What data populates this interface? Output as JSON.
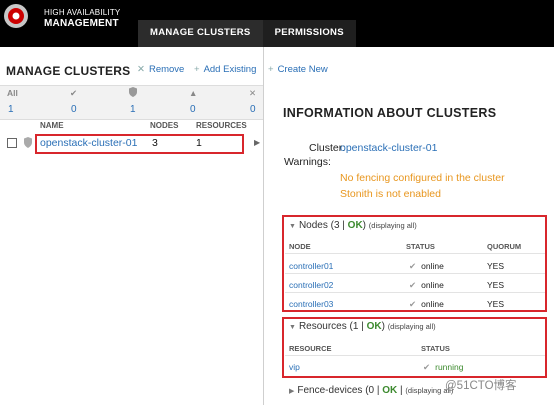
{
  "brand": {
    "line1": "HIGH AVAILABILITY",
    "line2": "MANAGEMENT"
  },
  "nav": {
    "tabs": [
      "MANAGE CLUSTERS",
      "PERMISSIONS"
    ]
  },
  "left": {
    "title": "MANAGE CLUSTERS",
    "actions": {
      "remove": "Remove",
      "add": "Add Existing",
      "create": "Create New"
    },
    "filters": {
      "all_label": "All",
      "counts": [
        "1",
        "0",
        "1",
        "0",
        "0"
      ]
    },
    "columns": {
      "name": "NAME",
      "nodes": "NODES",
      "resources": "RESOURCES"
    },
    "clusters": [
      {
        "name": "openstack-cluster-01",
        "nodes": "3",
        "resources": "1"
      }
    ]
  },
  "right": {
    "title": "INFORMATION ABOUT CLUSTERS",
    "cluster_label": "Cluster:",
    "cluster_value": "openstack-cluster-01",
    "warnings_label": "Warnings:",
    "warnings": [
      "No fencing configured in the cluster",
      "Stonith is not enabled"
    ],
    "nodes": {
      "header_prefix": "Nodes (3 | ",
      "ok": "OK",
      "header_suffix": ")",
      "displaying": "(displaying all)",
      "columns": [
        "NODE",
        "STATUS",
        "QUORUM"
      ],
      "rows": [
        {
          "name": "controller01",
          "status": "online",
          "quorum": "YES"
        },
        {
          "name": "controller02",
          "status": "online",
          "quorum": "YES"
        },
        {
          "name": "controller03",
          "status": "online",
          "quorum": "YES"
        }
      ]
    },
    "resources": {
      "header_prefix": "Resources (1 | ",
      "ok": "OK",
      "header_suffix": ")",
      "displaying": "(displaying all)",
      "columns": [
        "RESOURCE",
        "STATUS"
      ],
      "rows": [
        {
          "name": "vip",
          "status": "running"
        }
      ]
    },
    "fence": {
      "header_prefix": "Fence-devices (0 | ",
      "ok": "OK",
      "displaying": "(displaying all)"
    }
  },
  "watermark": "@51CTO博客",
  "colors": {
    "accent_link": "#2a6fb6",
    "ok_green": "#3c8a2e",
    "warning_orange": "#e8961e",
    "highlight_red": "#d8262c"
  }
}
